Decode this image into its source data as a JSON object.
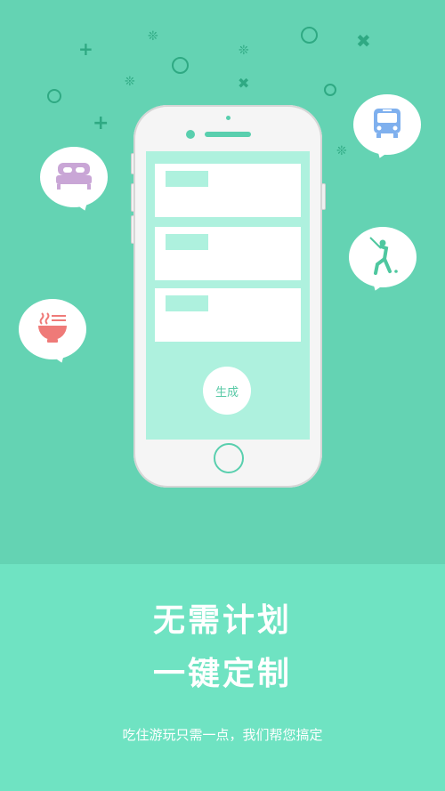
{
  "screen_button": "生成",
  "headline_line1": "无需计划",
  "headline_line2": "一键定制",
  "subtitle": "吃住游玩只需一点，我们帮您搞定",
  "icons": [
    "bed-icon",
    "noodle-bowl-icon",
    "bus-icon",
    "golf-icon"
  ],
  "colors": {
    "background": "#64d3b3",
    "bottom_panel": "#6fe3c2",
    "screen": "#aef1de",
    "accent": "#59cfae",
    "decor": "#2fa983"
  }
}
